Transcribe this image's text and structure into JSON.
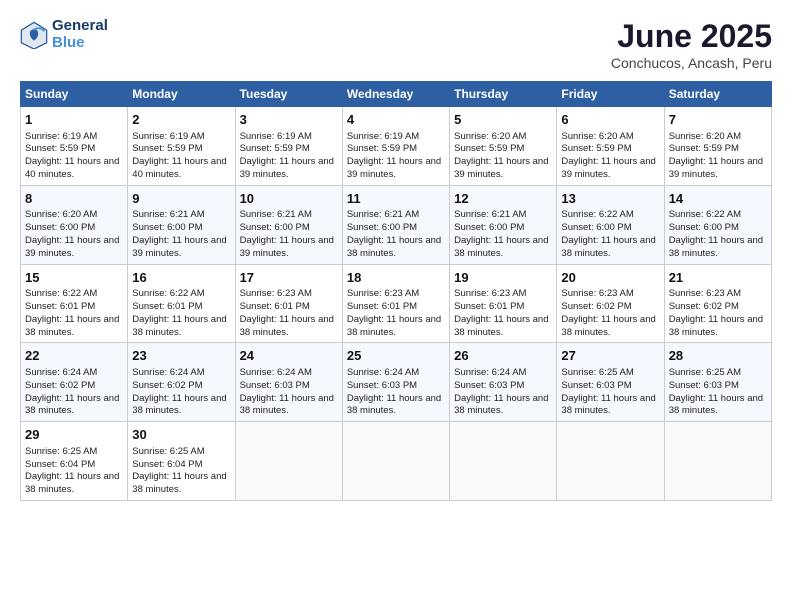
{
  "header": {
    "logo_line1": "General",
    "logo_line2": "Blue",
    "title": "June 2025",
    "subtitle": "Conchucos, Ancash, Peru"
  },
  "calendar": {
    "days_of_week": [
      "Sunday",
      "Monday",
      "Tuesday",
      "Wednesday",
      "Thursday",
      "Friday",
      "Saturday"
    ],
    "weeks": [
      [
        null,
        null,
        null,
        null,
        null,
        null,
        null
      ]
    ],
    "cells": [
      {
        "day": null,
        "content": ""
      },
      {
        "day": null,
        "content": ""
      },
      {
        "day": null,
        "content": ""
      },
      {
        "day": null,
        "content": ""
      },
      {
        "day": null,
        "content": ""
      },
      {
        "day": null,
        "content": ""
      },
      {
        "day": null,
        "content": ""
      },
      {
        "day": "1",
        "content": "Sunrise: 6:19 AM\nSunset: 5:59 PM\nDaylight: 11 hours and 40 minutes."
      },
      {
        "day": "2",
        "content": "Sunrise: 6:19 AM\nSunset: 5:59 PM\nDaylight: 11 hours and 40 minutes."
      },
      {
        "day": "3",
        "content": "Sunrise: 6:19 AM\nSunset: 5:59 PM\nDaylight: 11 hours and 39 minutes."
      },
      {
        "day": "4",
        "content": "Sunrise: 6:19 AM\nSunset: 5:59 PM\nDaylight: 11 hours and 39 minutes."
      },
      {
        "day": "5",
        "content": "Sunrise: 6:20 AM\nSunset: 5:59 PM\nDaylight: 11 hours and 39 minutes."
      },
      {
        "day": "6",
        "content": "Sunrise: 6:20 AM\nSunset: 5:59 PM\nDaylight: 11 hours and 39 minutes."
      },
      {
        "day": "7",
        "content": "Sunrise: 6:20 AM\nSunset: 5:59 PM\nDaylight: 11 hours and 39 minutes."
      },
      {
        "day": "8",
        "content": "Sunrise: 6:20 AM\nSunset: 6:00 PM\nDaylight: 11 hours and 39 minutes."
      },
      {
        "day": "9",
        "content": "Sunrise: 6:21 AM\nSunset: 6:00 PM\nDaylight: 11 hours and 39 minutes."
      },
      {
        "day": "10",
        "content": "Sunrise: 6:21 AM\nSunset: 6:00 PM\nDaylight: 11 hours and 39 minutes."
      },
      {
        "day": "11",
        "content": "Sunrise: 6:21 AM\nSunset: 6:00 PM\nDaylight: 11 hours and 38 minutes."
      },
      {
        "day": "12",
        "content": "Sunrise: 6:21 AM\nSunset: 6:00 PM\nDaylight: 11 hours and 38 minutes."
      },
      {
        "day": "13",
        "content": "Sunrise: 6:22 AM\nSunset: 6:00 PM\nDaylight: 11 hours and 38 minutes."
      },
      {
        "day": "14",
        "content": "Sunrise: 6:22 AM\nSunset: 6:00 PM\nDaylight: 11 hours and 38 minutes."
      },
      {
        "day": "15",
        "content": "Sunrise: 6:22 AM\nSunset: 6:01 PM\nDaylight: 11 hours and 38 minutes."
      },
      {
        "day": "16",
        "content": "Sunrise: 6:22 AM\nSunset: 6:01 PM\nDaylight: 11 hours and 38 minutes."
      },
      {
        "day": "17",
        "content": "Sunrise: 6:23 AM\nSunset: 6:01 PM\nDaylight: 11 hours and 38 minutes."
      },
      {
        "day": "18",
        "content": "Sunrise: 6:23 AM\nSunset: 6:01 PM\nDaylight: 11 hours and 38 minutes."
      },
      {
        "day": "19",
        "content": "Sunrise: 6:23 AM\nSunset: 6:01 PM\nDaylight: 11 hours and 38 minutes."
      },
      {
        "day": "20",
        "content": "Sunrise: 6:23 AM\nSunset: 6:02 PM\nDaylight: 11 hours and 38 minutes."
      },
      {
        "day": "21",
        "content": "Sunrise: 6:23 AM\nSunset: 6:02 PM\nDaylight: 11 hours and 38 minutes."
      },
      {
        "day": "22",
        "content": "Sunrise: 6:24 AM\nSunset: 6:02 PM\nDaylight: 11 hours and 38 minutes."
      },
      {
        "day": "23",
        "content": "Sunrise: 6:24 AM\nSunset: 6:02 PM\nDaylight: 11 hours and 38 minutes."
      },
      {
        "day": "24",
        "content": "Sunrise: 6:24 AM\nSunset: 6:03 PM\nDaylight: 11 hours and 38 minutes."
      },
      {
        "day": "25",
        "content": "Sunrise: 6:24 AM\nSunset: 6:03 PM\nDaylight: 11 hours and 38 minutes."
      },
      {
        "day": "26",
        "content": "Sunrise: 6:24 AM\nSunset: 6:03 PM\nDaylight: 11 hours and 38 minutes."
      },
      {
        "day": "27",
        "content": "Sunrise: 6:25 AM\nSunset: 6:03 PM\nDaylight: 11 hours and 38 minutes."
      },
      {
        "day": "28",
        "content": "Sunrise: 6:25 AM\nSunset: 6:03 PM\nDaylight: 11 hours and 38 minutes."
      },
      {
        "day": "29",
        "content": "Sunrise: 6:25 AM\nSunset: 6:04 PM\nDaylight: 11 hours and 38 minutes."
      },
      {
        "day": "30",
        "content": "Sunrise: 6:25 AM\nSunset: 6:04 PM\nDaylight: 11 hours and 38 minutes."
      },
      {
        "day": null,
        "content": ""
      },
      {
        "day": null,
        "content": ""
      },
      {
        "day": null,
        "content": ""
      },
      {
        "day": null,
        "content": ""
      },
      {
        "day": null,
        "content": ""
      },
      {
        "day": null,
        "content": ""
      }
    ]
  }
}
